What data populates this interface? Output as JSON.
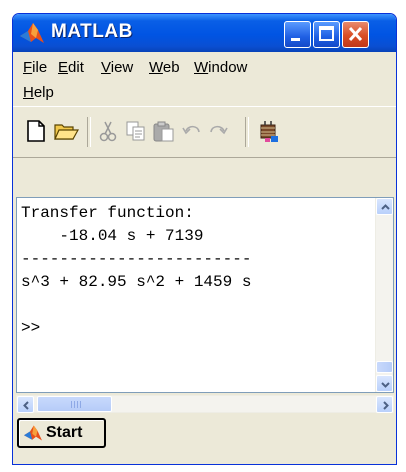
{
  "window": {
    "title": "MATLAB",
    "title_icon": "matlab-logo-icon",
    "controls": [
      "minimize-icon",
      "maximize-icon",
      "close-icon"
    ]
  },
  "menubar": {
    "row1": [
      "File",
      "Edit",
      "View",
      "Web",
      "Window"
    ],
    "row2": [
      "Help"
    ]
  },
  "toolbar": {
    "icons": [
      "new-file-icon",
      "open-folder-icon",
      "cut-icon",
      "copy-icon",
      "paste-icon",
      "undo-icon",
      "redo-icon",
      "simulink-icon"
    ]
  },
  "command_window": {
    "line1": "Transfer function:",
    "line2": "    -18.04 s + 7139",
    "line3": "------------------------",
    "line4": "s^3 + 82.95 s^2 + 1459 s",
    "prompt": ">>"
  },
  "start_button": {
    "label": "Start"
  },
  "colors": {
    "titlebar": "#0054E3",
    "close_button": "#D94D24",
    "window_face": "#ECE9D8"
  }
}
